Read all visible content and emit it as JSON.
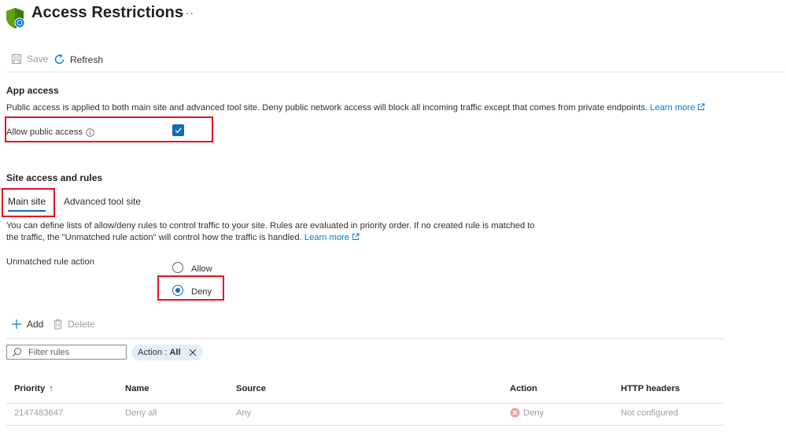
{
  "header": {
    "title": "Access Restrictions",
    "more_label": "···"
  },
  "toolbar": {
    "save_label": "Save",
    "refresh_label": "Refresh"
  },
  "app_access": {
    "title": "App access",
    "description": "Public access is applied to both main site and advanced tool site. Deny public network access will block all incoming traffic except that comes from private endpoints.",
    "learn_more": "Learn more",
    "allow_public_label": "Allow public access",
    "allow_public_checked": true
  },
  "site_access": {
    "title": "Site access and rules",
    "tabs": [
      {
        "label": "Main site",
        "active": true
      },
      {
        "label": "Advanced tool site",
        "active": false
      }
    ],
    "description_line1": "You can define lists of allow/deny rules to control traffic to your site. Rules are evaluated in priority order. If no created rule is matched to",
    "description_line2": "the traffic, the \"Unmatched rule action\" will control how the traffic is handled.",
    "learn_more": "Learn more",
    "unmatched_label": "Unmatched rule action",
    "options": [
      {
        "label": "Allow",
        "checked": false
      },
      {
        "label": "Deny",
        "checked": true
      }
    ]
  },
  "rules_toolbar": {
    "add_label": "Add",
    "delete_label": "Delete"
  },
  "filter": {
    "placeholder": "Filter rules",
    "pill_key": "Action :",
    "pill_value": "All"
  },
  "table": {
    "columns": [
      "Priority",
      "Name",
      "Source",
      "Action",
      "HTTP headers"
    ],
    "sort_indicator": "↑",
    "rows": [
      {
        "priority": "2147483647",
        "name": "Deny all",
        "source": "Any",
        "action": "Deny",
        "http_headers": "Not configured"
      }
    ]
  },
  "colors": {
    "accent": "#0f6cbd",
    "link": "#0078d4",
    "highlight": "#e81123",
    "deny": "#d13438"
  }
}
